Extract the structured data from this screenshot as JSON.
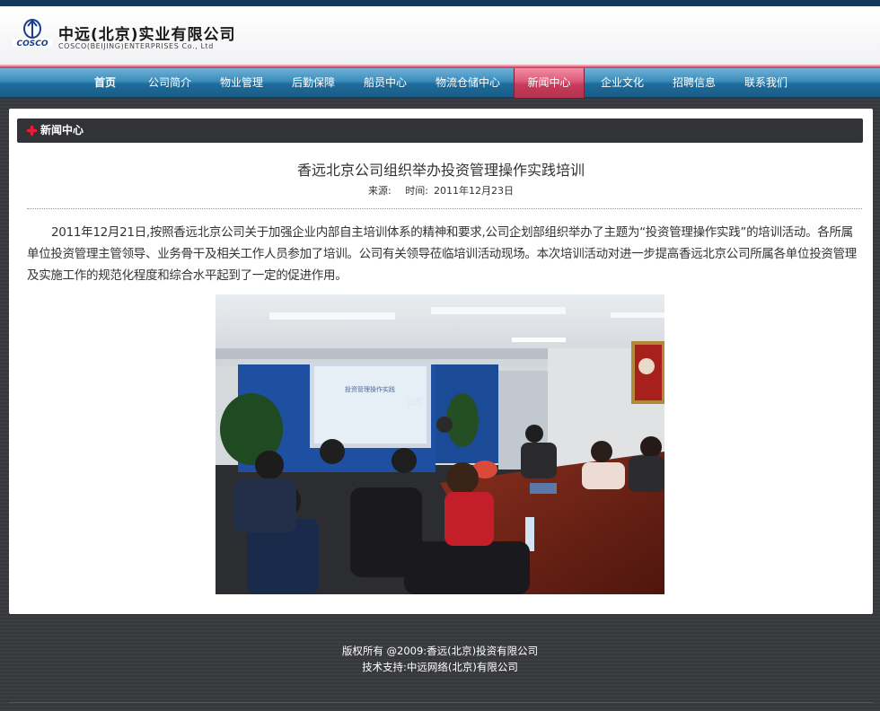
{
  "header": {
    "brand_cn": "中远(北京)实业有限公司",
    "brand_en": "COSCO(BEIJING)ENTERPRISES Co., Ltd",
    "logo_text": "COSCO"
  },
  "nav": {
    "items": [
      {
        "label": "首页"
      },
      {
        "label": "公司简介"
      },
      {
        "label": "物业管理"
      },
      {
        "label": "后勤保障"
      },
      {
        "label": "船员中心"
      },
      {
        "label": "物流仓储中心"
      },
      {
        "label": "新闻中心"
      },
      {
        "label": "企业文化"
      },
      {
        "label": "招聘信息"
      },
      {
        "label": "联系我们"
      }
    ],
    "active": "新闻中心"
  },
  "section": {
    "title": "新闻中心"
  },
  "article": {
    "title": "香远北京公司组织举办投资管理操作实践培训",
    "source_label": "来源:",
    "source_value": "",
    "time_label": "时间:",
    "time_value": "2011年12月23日",
    "body": "2011年12月21日,按照香远北京公司关于加强企业内部自主培训体系的精神和要求,公司企划部组织举办了主题为“投资管理操作实践”的培训活动。各所属单位投资管理主管领导、业务骨干及相关工作人员参加了培训。公司有关领导莅临培训活动现场。本次培训活动对进一步提高香远北京公司所属各单位投资管理及实施工作的规范化程度和综合水平起到了一定的促进作用。",
    "photo_screen_text": "投资管理操作实践",
    "photo_wall_text": "公司"
  },
  "footer": {
    "copyright": "版权所有 @2009:香远(北京)投资有限公司",
    "support": "技术支持:中远网络(北京)有限公司"
  },
  "colors": {
    "nav_blue": "#2c7fb0",
    "nav_active": "#d14b69",
    "page_bg": "#3a3b3f",
    "section_bar": "#323337",
    "section_icon": "#e0203a"
  }
}
